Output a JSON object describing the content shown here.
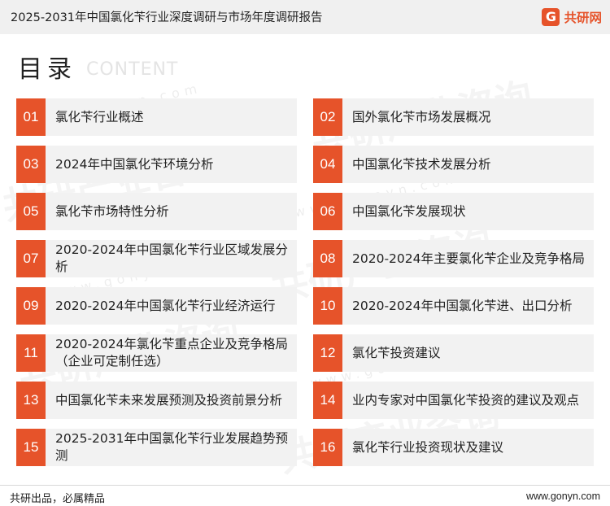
{
  "header": {
    "title": "2025-2031年中国氯化苄行业深度调研与市场年度调研报告",
    "logo_mark": "G",
    "logo_text": "共研网"
  },
  "toc": {
    "heading": "目录",
    "subheading": "CONTENT"
  },
  "watermark": {
    "brand": "共研产业咨询",
    "url": "www.gonyn.com"
  },
  "items": [
    {
      "num": "01",
      "label": "氯化苄行业概述"
    },
    {
      "num": "02",
      "label": "国外氯化苄市场发展概况"
    },
    {
      "num": "03",
      "label": "2024年中国氯化苄环境分析"
    },
    {
      "num": "04",
      "label": "中国氯化苄技术发展分析"
    },
    {
      "num": "05",
      "label": "氯化苄市场特性分析"
    },
    {
      "num": "06",
      "label": "中国氯化苄发展现状"
    },
    {
      "num": "07",
      "label": "2020-2024年中国氯化苄行业区域发展分析"
    },
    {
      "num": "08",
      "label": "2020-2024年主要氯化苄企业及竞争格局"
    },
    {
      "num": "09",
      "label": "2020-2024年中国氯化苄行业经济运行"
    },
    {
      "num": "10",
      "label": "2020-2024年中国氯化苄进、出口分析"
    },
    {
      "num": "11",
      "label": "2020-2024年氯化苄重点企业及竞争格局（企业可定制任选）"
    },
    {
      "num": "12",
      "label": "氯化苄投资建议"
    },
    {
      "num": "13",
      "label": "中国氯化苄未来发展预测及投资前景分析"
    },
    {
      "num": "14",
      "label": "业内专家对中国氯化苄投资的建议及观点"
    },
    {
      "num": "15",
      "label": "2025-2031年中国氯化苄行业发展趋势预测"
    },
    {
      "num": "16",
      "label": "氯化苄行业投资现状及建议"
    }
  ],
  "footer": {
    "left": "共研出品，必属精品",
    "right": "www.gonyn.com"
  },
  "colors": {
    "accent": "#e6532a",
    "item_bg": "#f2f2f2",
    "header_bg": "#f0f0f0"
  }
}
